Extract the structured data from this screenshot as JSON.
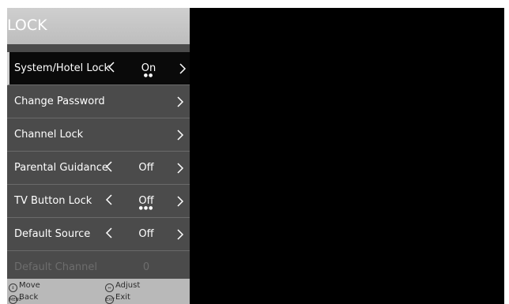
{
  "menu": {
    "title": "LOCK",
    "items": [
      {
        "label": "System/Hotel Lock",
        "value": "On",
        "dots": "●●",
        "has_left": true
      },
      {
        "label": "Change Password",
        "value": "",
        "dots": "",
        "has_left": false
      },
      {
        "label": "Channel Lock",
        "value": "",
        "dots": "",
        "has_left": false
      },
      {
        "label": "Parental Guidance",
        "value": "Off",
        "dots": "",
        "has_left": true
      },
      {
        "label": "TV Button Lock",
        "value": "Off",
        "dots": "●●●",
        "has_left": true
      },
      {
        "label": "Default Source",
        "value": "Off",
        "dots": "",
        "has_left": true
      },
      {
        "label": "Default Channel",
        "value": "0",
        "dots": "",
        "has_left": false
      }
    ]
  },
  "footer": {
    "move": "Move",
    "adjust": "Adjust",
    "back": "Back",
    "exit": "Exit",
    "back_key": "MENU",
    "exit_key": "EXIT"
  },
  "colors": {
    "panel": "#4b4b4b",
    "selected": "#0a0a0a",
    "title_bar": "#c4c4c4",
    "footer": "#b9b9b9",
    "disabled_text": "#6d6d6d"
  },
  "icons": {
    "left": "chevron-left-icon",
    "right": "chevron-right-icon",
    "move": "up-down-icon",
    "adjust": "left-right-icon"
  }
}
